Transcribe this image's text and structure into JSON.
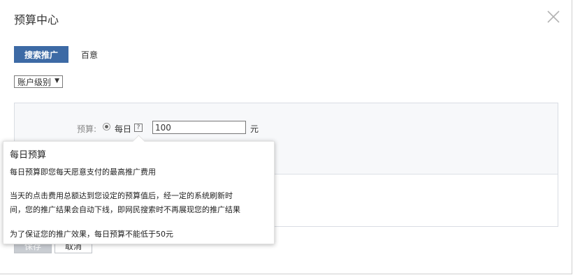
{
  "dialog": {
    "title": "预算中心",
    "close_icon": "close-icon"
  },
  "tabs": {
    "active": "搜索推广",
    "other": "百意"
  },
  "level_select": {
    "value": "账户级别",
    "arrow": "▼"
  },
  "budget": {
    "label": "预算:",
    "option_label": "每日",
    "help": "?",
    "value": "100",
    "unit": "元"
  },
  "buttons": {
    "save": "保存",
    "cancel": "取消"
  },
  "tooltip": {
    "title": "每日预算",
    "line1": "每日预算即您每天愿意支付的最高推广费用",
    "line2": "当天的点击费用总额达到您设定的预算值后，经一定的系统刷新时",
    "line3": "间，您的推广结果会自动下线，即网民搜索时不再展现您的推广结果",
    "line4": "为了保证您的推广效果，每日预算不能低于50元"
  },
  "colors": {
    "accent": "#3d6aa5",
    "panel_bg": "#f7f8fa"
  }
}
